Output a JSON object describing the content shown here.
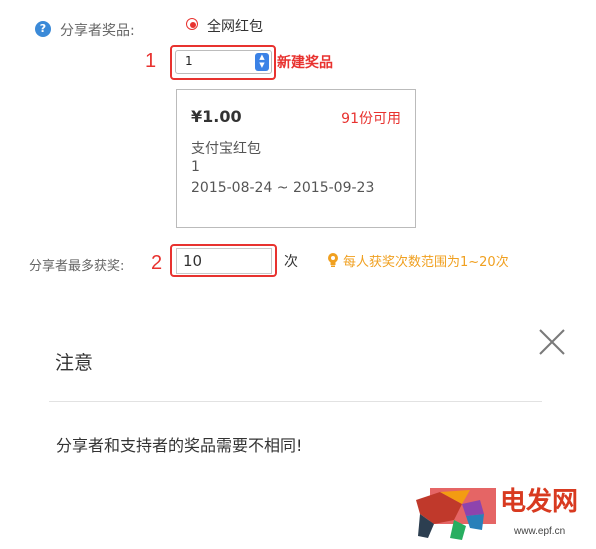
{
  "prize_row": {
    "label": "分享者奖品:",
    "help_icon": "question-circle-icon",
    "radio_label": "全网红包",
    "marker": "1",
    "select_value": "1",
    "new_prize_link": "新建奖品"
  },
  "prize_card": {
    "amount": "¥1.00",
    "available": "91份可用",
    "type": "支付宝红包",
    "quantity": "1",
    "dates": "2015-08-24 ~ 2015-09-23"
  },
  "max_row": {
    "label": "分享者最多获奖:",
    "marker": "2",
    "value": "10",
    "unit": "次",
    "hint_icon": "lightbulb-icon",
    "hint": "每人获奖次数范围为1~20次"
  },
  "dialog": {
    "title": "注意",
    "close_icon": "close-icon",
    "message": "分享者和支持者的奖品需要不相同!"
  },
  "watermark": {
    "text": "电发网",
    "url": "www.epf.cn"
  },
  "colors": {
    "accent_red": "#e8322f",
    "hint_orange": "#f0a020",
    "help_blue": "#3b8ad8",
    "select_blue": "#3b82e6"
  }
}
